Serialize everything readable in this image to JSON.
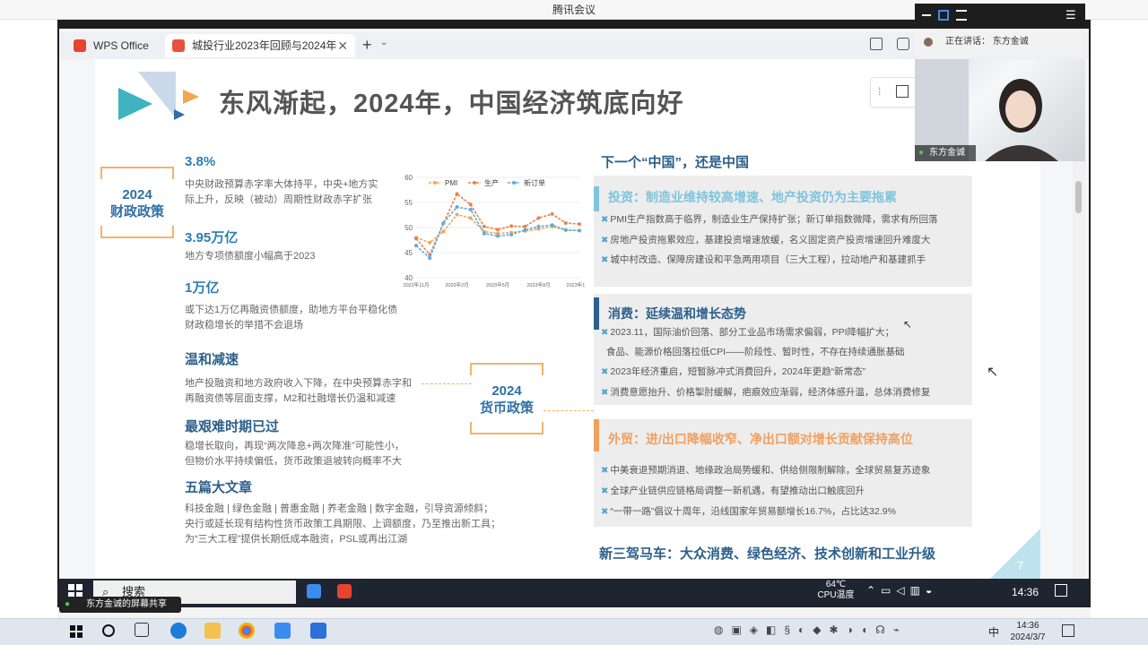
{
  "meeting": {
    "window_title": "腾讯会议"
  },
  "wps": {
    "tab_home": "WPS Office",
    "tab_doc": "城投行业2023年回顾与2024年",
    "new_tab": "+"
  },
  "slide": {
    "title": "东风渐起，2024年，中国经济筑底向好",
    "page_number": "7",
    "left": {
      "fiscal_label_l1": "2024",
      "fiscal_label_l2": "财政政策",
      "monetary_label_l1": "2024",
      "monetary_label_l2": "货币政策",
      "items": [
        {
          "head": "3.8%",
          "text": "中央财政预算赤字率大体持平，中央+地方实\n际上升，反映（被动）周期性财政赤字扩张"
        },
        {
          "head": "3.95万亿",
          "text": "地方专项债额度小幅高于2023"
        },
        {
          "head": "1万亿",
          "text": "或下达1万亿再融资债额度，助地方平台平稳化债\n财政稳增长的举措不会退场"
        },
        {
          "head": "温和减速",
          "text": "地产投融资和地方政府收入下降，在中央预算赤字和\n再融资债等层面支撑，M2和社融增长仍温和减速"
        },
        {
          "head": "最艰难时期已过",
          "text": "稳增长取向，再现“两次降息+两次降准”可能性小，\n但物价水平持续偏低，货币政策退坡转向概率不大"
        },
        {
          "head": "五篇大文章",
          "text": "科技金融 | 绿色金融 | 普惠金融 | 养老金融 | 数字金融，引导资源倾斜；\n央行或延长现有结构性货币政策工具期限、上调额度，乃至推出新工具；\n为“三大工程”提供长期低成本融资，PSL或再出江湖"
        }
      ]
    },
    "right": {
      "heading": "下一个“中国”，还是中国",
      "sections": [
        {
          "title": "投资：制造业维持较高增速、地产投资仍为主要拖累",
          "color": "#7ec4dc",
          "bullets": [
            "PMI生产指数高于临界，制造业生产保持扩张；新订单指数微降，需求有所回落",
            "房地产投资拖累效应，基建投资增速放缓，名义固定资产投资增速回升难度大",
            "城中村改造、保障房建设和平急两用项目（三大工程），拉动地产和基建抓手"
          ]
        },
        {
          "title": "消费：延续温和增长态势",
          "color": "#2c5f8a",
          "bullets": [
            "2023.11，国际油价回落、部分工业品市场需求偏弱，PPI降幅扩大；",
            "食品、能源价格回落拉低CPI——阶段性、暂时性，不存在持续通胀基础",
            "2023年经济重启，短暂脉冲式消费回升，2024年更趋“新常态”",
            "消费意愿抬升、价格掣肘缓解，疤痕效应渐弱，经济体感升温，总体消费修复"
          ]
        },
        {
          "title": "外贸：进/出口降幅收窄、净出口额对增长贡献保持高位",
          "color": "#f0a060",
          "bullets": [
            "中美衰退预期消退、地缘政治局势缓和、供给侧限制解除，全球贸易复苏迹象",
            "全球产业链供应链格局调整一新机遇，有望推动出口触底回升",
            "“一带一路”倡议十周年，沿线国家年贸易额增长16.7%，占比达32.9%"
          ]
        }
      ],
      "footer": "新三驾马车：大众消费、绿色经济、技术创新和工业升级"
    }
  },
  "chart_data": {
    "type": "line",
    "ylim": [
      40,
      60
    ],
    "yticks": [
      "60",
      "55",
      "50",
      "45",
      "40"
    ],
    "x_tick_labels": [
      "2022年11月",
      "2023年2月",
      "2023年5月",
      "2023年8月",
      "2023年11月"
    ],
    "series": [
      {
        "name": "PMI",
        "color": "#f2a65a",
        "values": [
          48.0,
          47.0,
          49.2,
          52.6,
          51.9,
          49.2,
          48.8,
          49.0,
          49.3,
          49.7,
          50.2,
          49.5,
          49.4
        ]
      },
      {
        "name": "生产",
        "color": "#e9834a",
        "values": [
          47.8,
          44.6,
          50.8,
          56.7,
          54.6,
          50.2,
          49.6,
          50.3,
          50.2,
          51.9,
          52.7,
          50.9,
          50.7
        ]
      },
      {
        "name": "新订单",
        "color": "#5aaee0",
        "values": [
          46.4,
          43.9,
          50.9,
          54.1,
          53.6,
          48.8,
          48.3,
          48.6,
          49.5,
          50.2,
          50.5,
          49.5,
          49.4
        ]
      }
    ]
  },
  "video": {
    "speaking_label": "正在讲话：",
    "speaker": "东方金诚",
    "name_tag": "东方金诚"
  },
  "remote_taskbar": {
    "search_placeholder": "搜索",
    "temp": "64℃",
    "temp_label": "CPU温度",
    "time": "14:36"
  },
  "share_pill": "东方金诚的屏幕共享",
  "host_taskbar": {
    "time": "14:36",
    "date": "2024/3/7"
  }
}
